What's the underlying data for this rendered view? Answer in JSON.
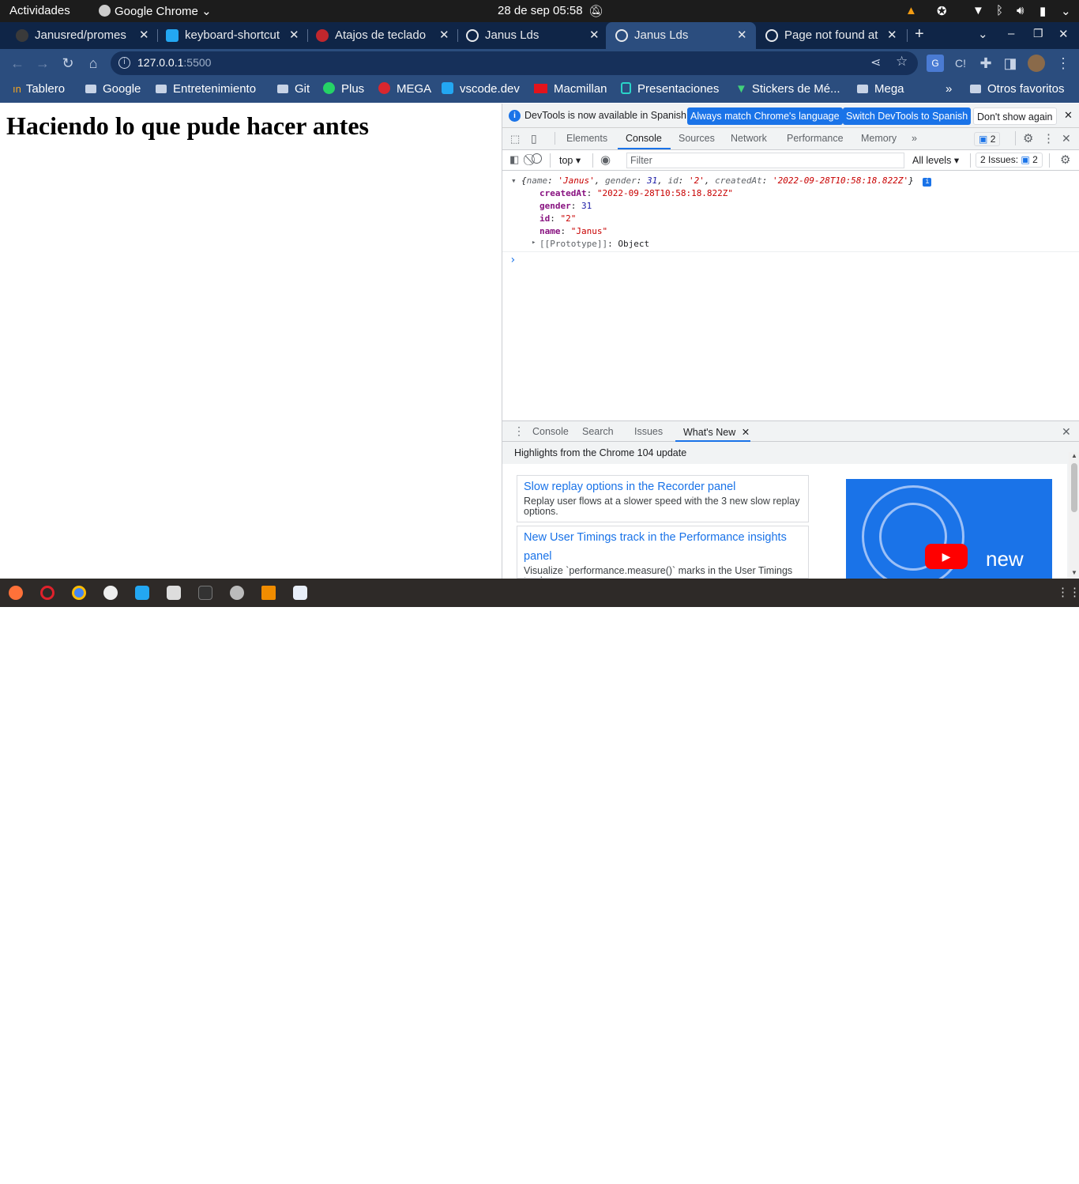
{
  "topbar": {
    "activities": "Actividades",
    "app_name": "Google Chrome",
    "clock": "28 de sep  05:58"
  },
  "tabs": [
    {
      "title": "Janusred/promes",
      "icon": "github-icon"
    },
    {
      "title": "keyboard-shortcut",
      "icon": "vscode-icon"
    },
    {
      "title": "Atajos de teclado",
      "icon": "site-icon"
    },
    {
      "title": "Janus Lds",
      "icon": "globe-icon"
    },
    {
      "title": "Janus Lds",
      "icon": "globe-icon"
    },
    {
      "title": "Page not found at",
      "icon": "globe-icon"
    }
  ],
  "omnibox": {
    "host": "127.0.0.1",
    "port": ":5500"
  },
  "bookmarks": [
    {
      "label": "Tablero"
    },
    {
      "label": "Google"
    },
    {
      "label": "Entretenimiento"
    },
    {
      "label": "Git"
    },
    {
      "label": "Plus"
    },
    {
      "label": "MEGA"
    },
    {
      "label": "vscode.dev"
    },
    {
      "label": "Macmillan"
    },
    {
      "label": "Presentaciones"
    },
    {
      "label": "Stickers de Mé..."
    },
    {
      "label": "Mega"
    },
    {
      "label": "Otros favoritos"
    }
  ],
  "page": {
    "heading": "Haciendo lo que pude hacer antes"
  },
  "devtools": {
    "infobar": {
      "message": "DevTools is now available in Spanish!",
      "btn_match": "Always match Chrome's language",
      "btn_switch": "Switch DevTools to Spanish",
      "btn_dismiss": "Don't show again"
    },
    "tabs": [
      "Elements",
      "Console",
      "Sources",
      "Network",
      "Performance",
      "Memory"
    ],
    "issues_count": "2",
    "console_bar": {
      "context": "top",
      "filter_placeholder": "Filter",
      "levels": "All levels",
      "issues_label": "2 Issues:",
      "issues_num": "2"
    },
    "console": {
      "summary_open": "{",
      "summary_name_key": "name",
      "summary_name_val": "'Janus'",
      "summary_gender_key": "gender",
      "summary_gender_val": "31",
      "summary_id_key": "id",
      "summary_id_val": "'2'",
      "summary_created_key": "createdAt",
      "summary_created_val": "'2022-09-28T10:58:18.822Z'",
      "summary_close": "}",
      "props": [
        {
          "key": "createdAt",
          "value": "\"2022-09-28T10:58:18.822Z\"",
          "type": "s"
        },
        {
          "key": "gender",
          "value": "31",
          "type": "n"
        },
        {
          "key": "id",
          "value": "\"2\"",
          "type": "s"
        },
        {
          "key": "name",
          "value": "\"Janus\"",
          "type": "s"
        }
      ],
      "prototype_key": "[[Prototype]]",
      "prototype_val": "Object",
      "prompt": "›"
    },
    "drawer_tabs": [
      "Console",
      "Search",
      "Issues",
      "What's New"
    ],
    "whats_new": {
      "highlights": "Highlights from the Chrome 104 update",
      "cards": [
        {
          "title": "Slow replay options in the Recorder panel",
          "desc": "Replay user flows at a slower speed with the 3 new slow replay options."
        },
        {
          "title": "New User Timings track in the Performance insights panel",
          "desc": "Visualize `performance.measure()` marks in the User Timings track."
        }
      ],
      "promo_text": "new"
    }
  },
  "colors": {
    "tabstrip": "#0f2547",
    "toolbar": "#2b4d7e",
    "accent": "#1a73e8"
  }
}
